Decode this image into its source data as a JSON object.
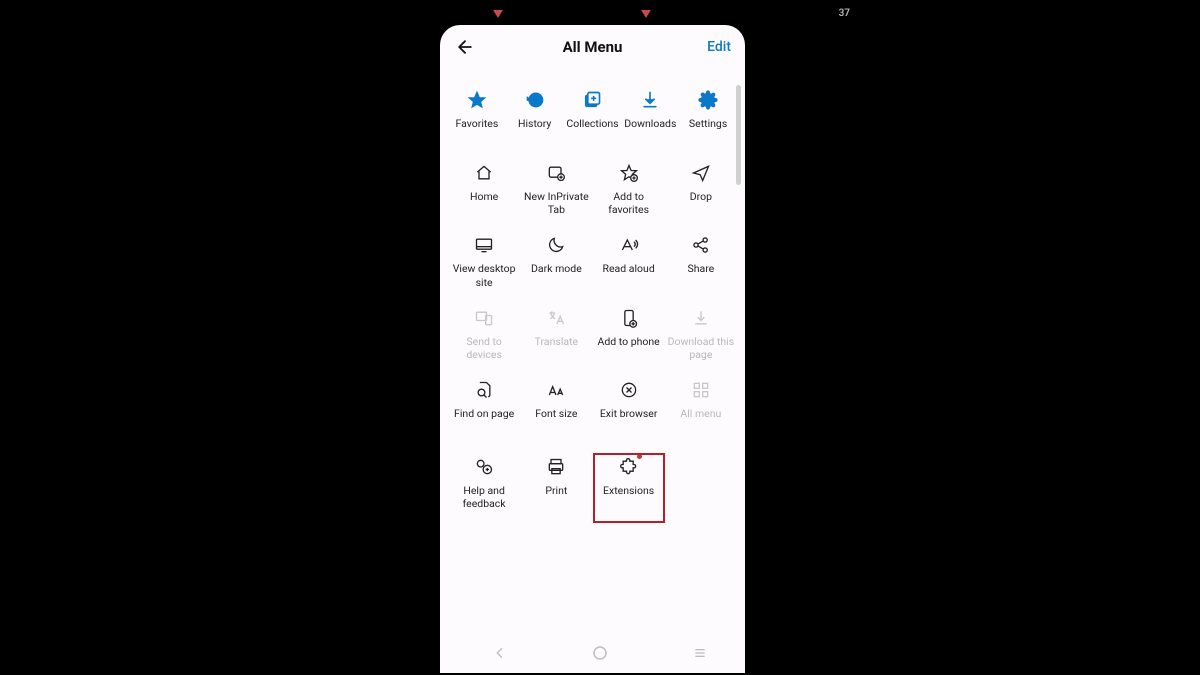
{
  "status": {
    "battery": "37"
  },
  "header": {
    "title": "All Menu",
    "edit": "Edit"
  },
  "colors": {
    "accent": "#0b78c8",
    "highlight": "#b3202a"
  },
  "topRow": [
    {
      "label": "Favorites"
    },
    {
      "label": "History"
    },
    {
      "label": "Collections"
    },
    {
      "label": "Downloads"
    },
    {
      "label": "Settings"
    }
  ],
  "grid": {
    "r1": [
      {
        "label": "Home"
      },
      {
        "label": "New InPrivate Tab"
      },
      {
        "label": "Add to favorites"
      },
      {
        "label": "Drop"
      }
    ],
    "r2": [
      {
        "label": "View desktop site"
      },
      {
        "label": "Dark mode"
      },
      {
        "label": "Read aloud"
      },
      {
        "label": "Share"
      }
    ],
    "r3": [
      {
        "label": "Send to devices",
        "disabled": true
      },
      {
        "label": "Translate",
        "disabled": true
      },
      {
        "label": "Add to phone"
      },
      {
        "label": "Download this page",
        "disabled": true
      }
    ],
    "r4": [
      {
        "label": "Find on page"
      },
      {
        "label": "Font size"
      },
      {
        "label": "Exit browser"
      },
      {
        "label": "All menu",
        "disabled": true
      }
    ],
    "r5": [
      {
        "label": "Help and feedback"
      },
      {
        "label": "Print"
      },
      {
        "label": "Extensions",
        "highlighted": true,
        "badge": true
      }
    ]
  }
}
